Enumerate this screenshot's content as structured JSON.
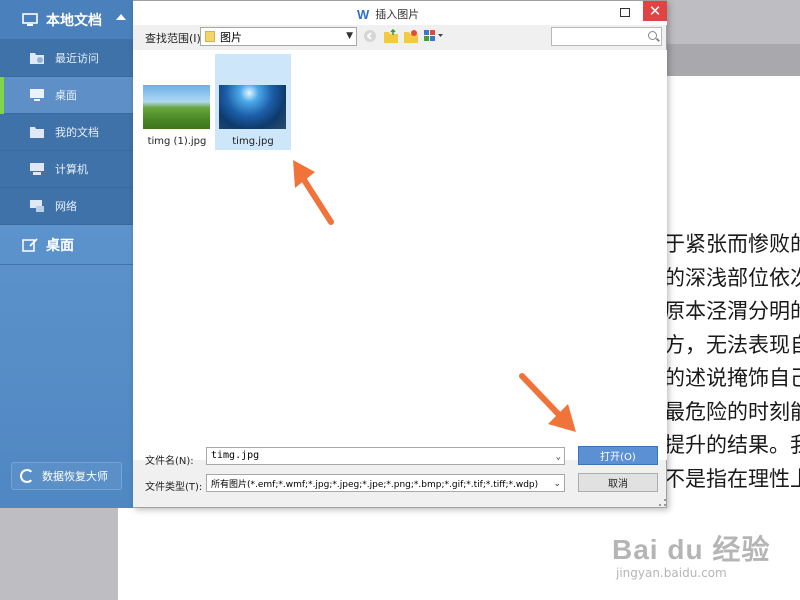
{
  "colors": {
    "panel_blue": "#4f87c2",
    "accent_green": "#7fd44c",
    "selection": "#cde6fa",
    "open_button": "#5b91d4",
    "close_red": "#e04343",
    "arrow_orange": "#f0733a"
  },
  "panel": {
    "title": "本地文档",
    "items": [
      {
        "label": "最近访问",
        "icon": "recent-folder-icon"
      },
      {
        "label": "桌面",
        "icon": "desktop-monitor-icon"
      },
      {
        "label": "我的文档",
        "icon": "folder-icon"
      },
      {
        "label": "计算机",
        "icon": "computer-icon"
      },
      {
        "label": "网络",
        "icon": "network-icon"
      }
    ],
    "section_label": "桌面",
    "recover_label": "数据恢复大师"
  },
  "dialog": {
    "title": "插入图片",
    "look_in_label": "查找范围(I):",
    "look_in_value": "图片",
    "files": [
      {
        "name": "timg (1).jpg",
        "selected": false
      },
      {
        "name": "timg.jpg",
        "selected": true
      }
    ],
    "filename_label": "文件名(N):",
    "filename_value": "timg.jpg",
    "filetype_label": "文件类型(T):",
    "filetype_value": "所有图片(*.emf;*.wmf;*.jpg;*.jpeg;*.jpe;*.png;*.bmp;*.gif;*.tif;*.tiff;*.wdp)",
    "open_label": "打开(O)",
    "cancel_label": "取消"
  },
  "document": {
    "lines": [
      "于紧张而惨败的",
      "的深浅部位依次",
      "原本泾渭分明的",
      "方，无法表现自",
      "的述说掩饰自己",
      "最危险的时刻能",
      "提升的结果。我",
      "不是指在理性上"
    ]
  },
  "watermark": {
    "main": "Bai du 经验",
    "sub": "jingyan.baidu.com"
  }
}
